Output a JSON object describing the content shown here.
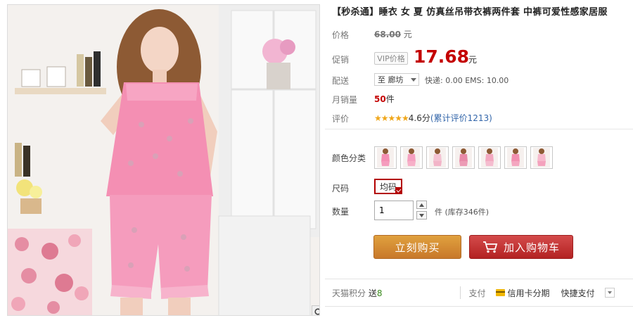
{
  "product": {
    "title": "【秒杀通】睡衣 女 夏 仿真丝吊带衣裤两件套 中裤可爱性感家居服"
  },
  "labels": {
    "price": "价格",
    "promo": "促销",
    "shipping": "配送",
    "monthly_sales": "月销量",
    "rating": "评价",
    "color": "颜色分类",
    "size": "尺码",
    "quantity": "数量"
  },
  "price": {
    "original": "68.00",
    "original_unit": "元",
    "vip_tag": "VIP价格",
    "promo": "17.68",
    "promo_unit": "元"
  },
  "shipping": {
    "selected_region": "至 廊坊",
    "fee_text": "快递: 0.00 EMS: 10.00"
  },
  "sales": {
    "count": "50",
    "unit": "件"
  },
  "rating": {
    "stars": "★★★★★",
    "score_text": "4.6分",
    "reviews_text": "(累计评价1213)",
    "star_color": "#f0a71b"
  },
  "sku": {
    "color_thumbs": [
      "thumb-1",
      "thumb-2",
      "thumb-3",
      "thumb-4",
      "thumb-5",
      "thumb-6",
      "thumb-7"
    ],
    "size_selected": "均码",
    "quantity_value": "1",
    "stock_text": "件 (库存346件)"
  },
  "buttons": {
    "buy_now": "立刻购买",
    "add_cart": "加入购物车"
  },
  "footer": {
    "points_label": "天猫积分",
    "points_send": "送",
    "points_value": "8",
    "pay_label": "支付",
    "credit": "信用卡分期",
    "quick_pay": "快捷支付"
  },
  "colors": {
    "accent_red": "#c40000",
    "buy_orange": "#d18a33",
    "cart_red": "#bf2a2a"
  }
}
